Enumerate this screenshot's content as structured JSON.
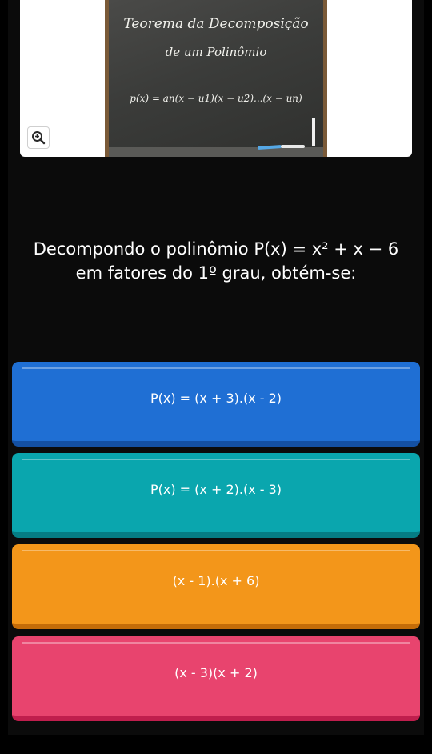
{
  "blackboard": {
    "title": "Teorema da Decomposição",
    "subtitle": "de um Polinômio",
    "formula": "p(x) = an(x − u1)(x − u2)...(x − un)"
  },
  "zoom": {
    "icon": "zoom-in-icon"
  },
  "question": {
    "line1": "Decompondo o polinômio P(x) = x² + x − 6",
    "line2": "em fatores do 1º grau, obtém-se:"
  },
  "answers": [
    {
      "label": "P(x) = (x + 3).(x - 2)",
      "color": "#1f6fd4"
    },
    {
      "label": "P(x) = (x + 2).(x - 3)",
      "color": "#0aa6ae"
    },
    {
      "label": "(x - 1).(x + 6)",
      "color": "#f3961a"
    },
    {
      "label": "(x - 3)(x + 2)",
      "color": "#e8446e"
    }
  ]
}
